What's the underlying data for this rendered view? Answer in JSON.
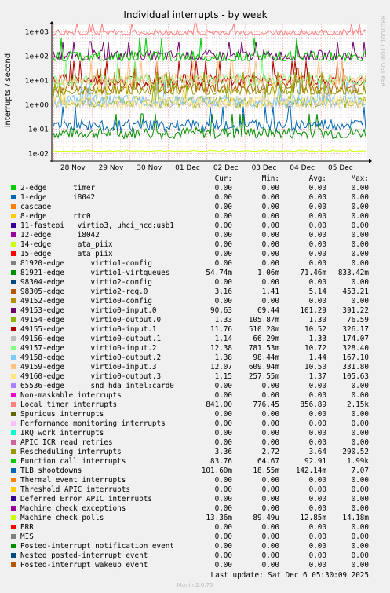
{
  "colors": {
    "background": "#f0f0f0",
    "plot": "#ffffff",
    "grid_major": "#ff8080",
    "grid_minor": "#e0c0c0"
  },
  "chart_data": {
    "type": "line",
    "title": "Individual interrupts - by week",
    "ylabel": "interrupts / second",
    "y_scale": "log",
    "ylim": [
      0.005,
      2000
    ],
    "y_ticks": [
      "1e-02",
      "1e-01",
      "1e+00",
      "1e+01",
      "1e+02",
      "1e+03"
    ],
    "x_ticks": [
      "28 Nov",
      "29 Nov",
      "30 Nov",
      "01 Dec",
      "02 Dec",
      "03 Dec",
      "04 Dec",
      "05 Dec"
    ],
    "grid": true,
    "side_label": "RRDTOOL / TOBI OETIKER"
  },
  "legend": {
    "headers": {
      "cur": "Cur:",
      "min": "Min:",
      "avg": "Avg:",
      "max": "Max:"
    },
    "rows": [
      {
        "label": "2-edge      timer",
        "color": "#00cc00",
        "cur": "0.00",
        "min": "0.00",
        "avg": "0.00",
        "max": "0.00"
      },
      {
        "label": "1-edge      i8042",
        "color": "#0066b3",
        "cur": "0.00",
        "min": "0.00",
        "avg": "0.00",
        "max": "0.00"
      },
      {
        "label": "cascade",
        "color": "#ff8000",
        "cur": "0.00",
        "min": "0.00",
        "avg": "0.00",
        "max": "0.00"
      },
      {
        "label": "8-edge      rtc0",
        "color": "#ffcc00",
        "cur": "0.00",
        "min": "0.00",
        "avg": "0.00",
        "max": "0.00"
      },
      {
        "label": "11-fasteoi   virtio3, uhci_hcd:usb1",
        "color": "#330099",
        "cur": "0.00",
        "min": "0.00",
        "avg": "0.00",
        "max": "0.00"
      },
      {
        "label": "12-edge      i8042",
        "color": "#990099",
        "cur": "0.00",
        "min": "0.00",
        "avg": "0.00",
        "max": "0.00"
      },
      {
        "label": "14-edge      ata_piix",
        "color": "#ccff00",
        "cur": "0.00",
        "min": "0.00",
        "avg": "0.00",
        "max": "0.00"
      },
      {
        "label": "15-edge      ata_piix",
        "color": "#ff0000",
        "cur": "0.00",
        "min": "0.00",
        "avg": "0.00",
        "max": "0.00"
      },
      {
        "label": "81920-edge      virtio1-config",
        "color": "#808080",
        "cur": "0.00",
        "min": "0.00",
        "avg": "0.00",
        "max": "0.00"
      },
      {
        "label": "81921-edge      virtio1-virtqueues",
        "color": "#008f00",
        "cur": "54.74m",
        "min": "1.06m",
        "avg": "71.46m",
        "max": "833.42m"
      },
      {
        "label": "98304-edge      virtio2-config",
        "color": "#00487d",
        "cur": "0.00",
        "min": "0.00",
        "avg": "0.00",
        "max": "0.00"
      },
      {
        "label": "98305-edge      virtio2-req.0",
        "color": "#b35a00",
        "cur": "3.16",
        "min": "1.41",
        "avg": "5.14",
        "max": "453.21"
      },
      {
        "label": "49152-edge      virtio0-config",
        "color": "#b38f00",
        "cur": "0.00",
        "min": "0.00",
        "avg": "0.00",
        "max": "0.00"
      },
      {
        "label": "49153-edge      virtio0-input.0",
        "color": "#6b006b",
        "cur": "90.63",
        "min": "69.44",
        "avg": "101.29",
        "max": "391.22"
      },
      {
        "label": "49154-edge      virtio0-output.0",
        "color": "#8fb300",
        "cur": "1.33",
        "min": "105.87m",
        "avg": "1.30",
        "max": "76.59"
      },
      {
        "label": "49155-edge      virtio0-input.1",
        "color": "#b30000",
        "cur": "11.76",
        "min": "510.28m",
        "avg": "10.52",
        "max": "326.17"
      },
      {
        "label": "49156-edge      virtio0-output.1",
        "color": "#bebebe",
        "cur": "1.14",
        "min": "66.29m",
        "avg": "1.33",
        "max": "174.07"
      },
      {
        "label": "49157-edge      virtio0-input.2",
        "color": "#80ff80",
        "cur": "12.38",
        "min": "781.53m",
        "avg": "10.72",
        "max": "328.40"
      },
      {
        "label": "49158-edge      virtio0-output.2",
        "color": "#80c9ff",
        "cur": "1.38",
        "min": "98.44m",
        "avg": "1.44",
        "max": "167.10"
      },
      {
        "label": "49159-edge      virtio0-input.3",
        "color": "#ffc080",
        "cur": "12.07",
        "min": "609.94m",
        "avg": "10.50",
        "max": "331.80"
      },
      {
        "label": "49160-edge      virtio0-output.3",
        "color": "#ffe680",
        "cur": "1.15",
        "min": "257.55m",
        "avg": "1.37",
        "max": "105.63"
      },
      {
        "label": "65536-edge      snd_hda_intel:card0",
        "color": "#aa80ff",
        "cur": "0.00",
        "min": "0.00",
        "avg": "0.00",
        "max": "0.00"
      },
      {
        "label": "Non-maskable interrupts",
        "color": "#ee00cc",
        "cur": "0.00",
        "min": "0.00",
        "avg": "0.00",
        "max": "0.00"
      },
      {
        "label": "Local timer interrupts",
        "color": "#ff8080",
        "cur": "841.00",
        "min": "776.45",
        "avg": "856.89",
        "max": "2.15k"
      },
      {
        "label": "Spurious interrupts",
        "color": "#666600",
        "cur": "0.00",
        "min": "0.00",
        "avg": "0.00",
        "max": "0.00"
      },
      {
        "label": "Performance monitoring interrupts",
        "color": "#ffbfff",
        "cur": "0.00",
        "min": "0.00",
        "avg": "0.00",
        "max": "0.00"
      },
      {
        "label": "IRQ work interrupts",
        "color": "#00ffcc",
        "cur": "0.00",
        "min": "0.00",
        "avg": "0.00",
        "max": "0.00"
      },
      {
        "label": "APIC ICR read retries",
        "color": "#cc6699",
        "cur": "0.00",
        "min": "0.00",
        "avg": "0.00",
        "max": "0.00"
      },
      {
        "label": "Rescheduling interrupts",
        "color": "#999900",
        "cur": "3.36",
        "min": "2.72",
        "avg": "3.64",
        "max": "290.52"
      },
      {
        "label": "Function call interrupts",
        "color": "#00cc00",
        "cur": "83.76",
        "min": "64.67",
        "avg": "92.91",
        "max": "1.99k"
      },
      {
        "label": "TLB shootdowns",
        "color": "#0066b3",
        "cur": "101.60m",
        "min": "18.55m",
        "avg": "142.14m",
        "max": "7.07"
      },
      {
        "label": "Thermal event interrupts",
        "color": "#ff8000",
        "cur": "0.00",
        "min": "0.00",
        "avg": "0.00",
        "max": "0.00"
      },
      {
        "label": "Threshold APIC interrupts",
        "color": "#ffcc00",
        "cur": "0.00",
        "min": "0.00",
        "avg": "0.00",
        "max": "0.00"
      },
      {
        "label": "Deferred Error APIC interrupts",
        "color": "#330099",
        "cur": "0.00",
        "min": "0.00",
        "avg": "0.00",
        "max": "0.00"
      },
      {
        "label": "Machine check exceptions",
        "color": "#990099",
        "cur": "0.00",
        "min": "0.00",
        "avg": "0.00",
        "max": "0.00"
      },
      {
        "label": "Machine check polls",
        "color": "#ccff00",
        "cur": "13.36m",
        "min": "89.49u",
        "avg": "12.85m",
        "max": "14.18m"
      },
      {
        "label": "ERR",
        "color": "#ff0000",
        "cur": "0.00",
        "min": "0.00",
        "avg": "0.00",
        "max": "0.00"
      },
      {
        "label": "MIS",
        "color": "#808080",
        "cur": "0.00",
        "min": "0.00",
        "avg": "0.00",
        "max": "0.00"
      },
      {
        "label": "Posted-interrupt notification event",
        "color": "#008f00",
        "cur": "0.00",
        "min": "0.00",
        "avg": "0.00",
        "max": "0.00"
      },
      {
        "label": "Nested posted-interrupt event",
        "color": "#00487d",
        "cur": "0.00",
        "min": "0.00",
        "avg": "0.00",
        "max": "0.00"
      },
      {
        "label": "Posted-interrupt wakeup event",
        "color": "#b35a00",
        "cur": "0.00",
        "min": "0.00",
        "avg": "0.00",
        "max": "0.00"
      }
    ]
  },
  "footer": {
    "last_update": "Last update: Sat Dec  6 05:30:09 2025",
    "munin": "Munin 2.0.75"
  }
}
